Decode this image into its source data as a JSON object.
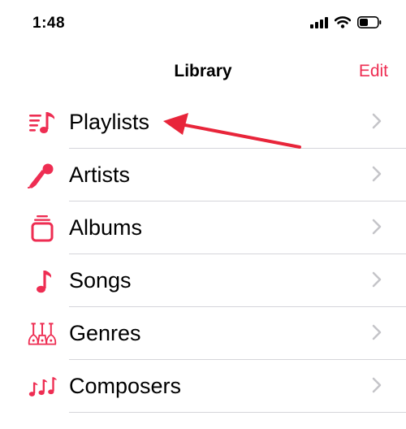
{
  "status_bar": {
    "time": "1:48"
  },
  "nav": {
    "title": "Library",
    "edit_label": "Edit"
  },
  "accent_color": "#ee2d52",
  "items": [
    {
      "label": "Playlists",
      "icon": "playlist-icon"
    },
    {
      "label": "Artists",
      "icon": "microphone-icon"
    },
    {
      "label": "Albums",
      "icon": "album-stack-icon"
    },
    {
      "label": "Songs",
      "icon": "music-note-icon"
    },
    {
      "label": "Genres",
      "icon": "guitars-icon"
    },
    {
      "label": "Composers",
      "icon": "composers-notes-icon"
    }
  ]
}
